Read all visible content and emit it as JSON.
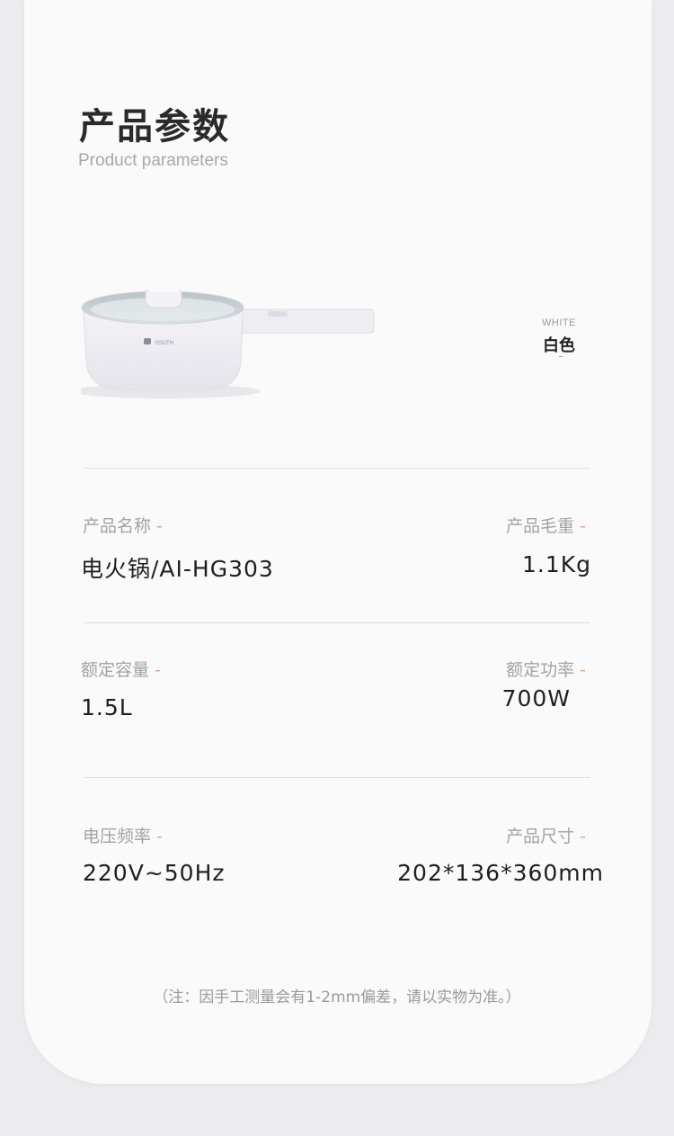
{
  "header": {
    "title": "产品参数",
    "subtitle": "Product parameters"
  },
  "product": {
    "brand_mark": "YOUTH",
    "color_en": "WHITE",
    "color_cn": "白色"
  },
  "specs": [
    {
      "label": "产品名称",
      "value": "电火锅/AI-HG303"
    },
    {
      "label": "产品毛重",
      "value": "1.1Kg"
    },
    {
      "label": "额定容量",
      "value": "1.5L"
    },
    {
      "label": "额定功率",
      "value": "700W"
    },
    {
      "label": "电压频率",
      "value": "220V~50Hz"
    },
    {
      "label": "产品尺寸",
      "value": "202*136*360mm"
    }
  ],
  "label_suffix": "-",
  "note": "（注：因手工测量会有1-2mm偏差，请以实物为准。）",
  "colors": {
    "accent_dash": "#e6a67d",
    "label_gray": "#a3a3a3",
    "value_dark": "#1f1f1f"
  }
}
